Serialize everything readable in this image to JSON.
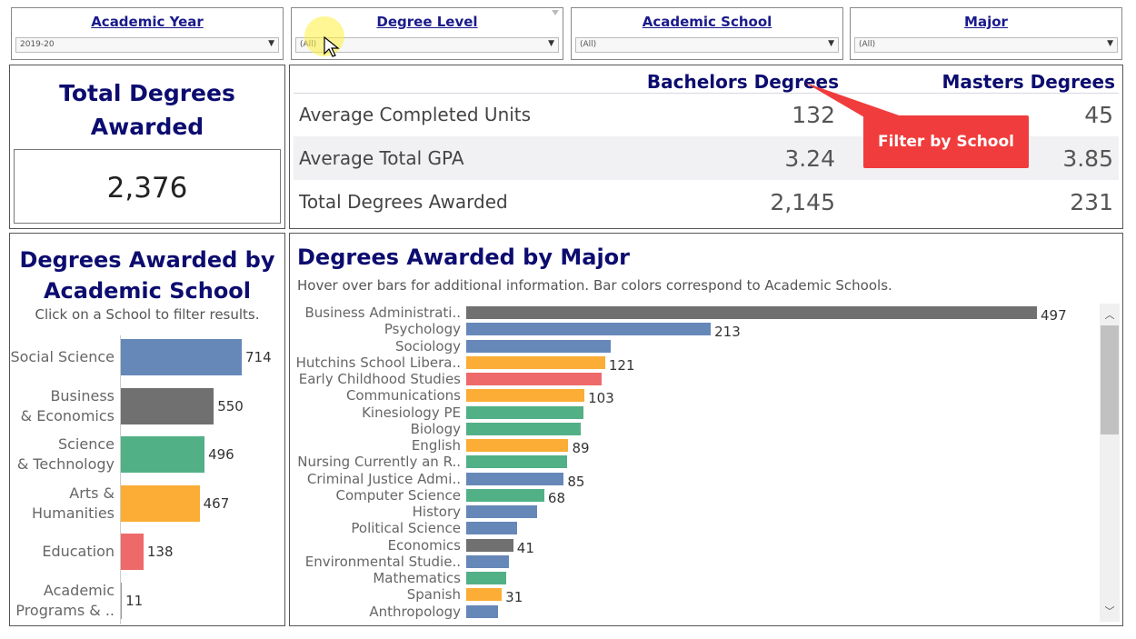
{
  "filters": [
    {
      "title": "Academic Year",
      "value": "2019-20"
    },
    {
      "title": "Degree Level",
      "value": "(All)"
    },
    {
      "title": "Academic School",
      "value": "(All)"
    },
    {
      "title": "Major",
      "value": "(All)"
    }
  ],
  "kpi": {
    "title": "Total Degrees Awarded",
    "value": "2,376"
  },
  "summary": {
    "col1": "Bachelors Degrees",
    "col2": "Masters Degrees",
    "rows": [
      {
        "label": "Average Completed Units",
        "bachelors": "132",
        "masters": "45"
      },
      {
        "label": "Average Total GPA",
        "bachelors": "3.24",
        "masters": "3.85"
      },
      {
        "label": "Total Degrees Awarded",
        "bachelors": "2,145",
        "masters": "231"
      }
    ]
  },
  "callout": {
    "text": "Filter by School"
  },
  "school_panel": {
    "title": "Degrees Awarded by Academic School",
    "subtitle": "Click on a School to filter results."
  },
  "major_panel": {
    "title": "Degrees Awarded by Major",
    "subtitle": "Hover over bars for additional information. Bar colors correspond to Academic Schools."
  },
  "colors": {
    "social_science": "#6688b8",
    "business": "#707070",
    "science": "#52b087",
    "arts": "#fbad35",
    "education": "#ee6a6a",
    "other": "#9a9a9a"
  },
  "chart_data": [
    {
      "type": "bar",
      "orientation": "horizontal",
      "categories": [
        "Social Science",
        "Business & Economics",
        "Science & Technology",
        "Arts & Humanities",
        "Education",
        "Academic Programs & .."
      ],
      "values": [
        714,
        550,
        496,
        467,
        138,
        11
      ],
      "colors": [
        "#6688b8",
        "#707070",
        "#52b087",
        "#fbad35",
        "#ee6a6a",
        "#9a9a9a"
      ],
      "labels_shown": [
        true,
        true,
        true,
        true,
        true,
        true
      ]
    },
    {
      "type": "bar",
      "orientation": "horizontal",
      "categories": [
        "Business Administrati..",
        "Psychology",
        "Sociology",
        "Hutchins School Libera..",
        "Early Childhood Studies",
        "Communications",
        "Kinesiology PE",
        "Biology",
        "English",
        "Nursing Currently an R..",
        "Criminal Justice Admi..",
        "Computer Science",
        "History",
        "Political Science",
        "Economics",
        "Environmental Studie..",
        "Mathematics",
        "Spanish",
        "Anthropology"
      ],
      "values": [
        497,
        213,
        126,
        121,
        118,
        103,
        102,
        100,
        89,
        88,
        85,
        68,
        62,
        44,
        41,
        37,
        35,
        31,
        28
      ],
      "colors": [
        "#707070",
        "#6688b8",
        "#6688b8",
        "#fbad35",
        "#ee6a6a",
        "#fbad35",
        "#52b087",
        "#52b087",
        "#fbad35",
        "#52b087",
        "#6688b8",
        "#52b087",
        "#6688b8",
        "#6688b8",
        "#707070",
        "#6688b8",
        "#52b087",
        "#fbad35",
        "#6688b8"
      ],
      "labels_shown": [
        true,
        true,
        false,
        true,
        false,
        true,
        false,
        false,
        true,
        false,
        true,
        true,
        false,
        false,
        true,
        false,
        false,
        true,
        false
      ]
    }
  ]
}
